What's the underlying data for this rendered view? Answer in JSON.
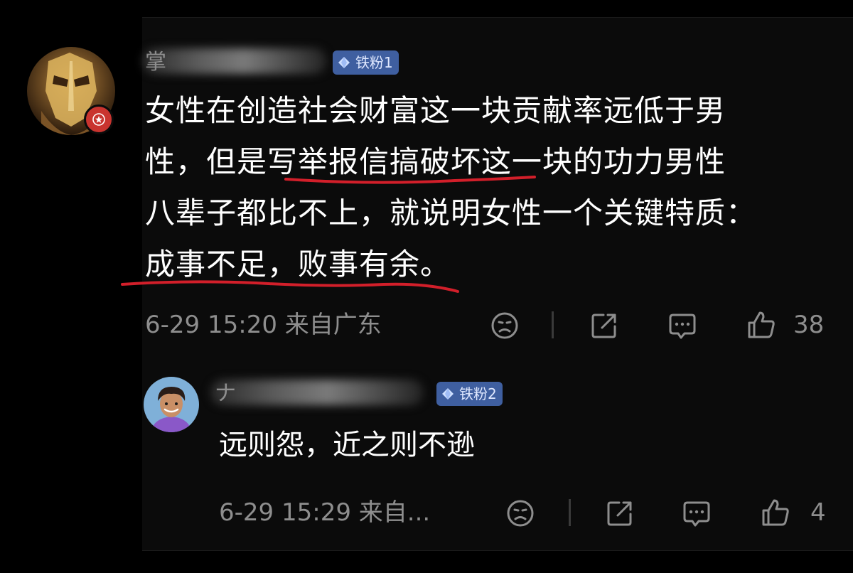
{
  "comment": {
    "username_hint": "掌",
    "fan_badge": "铁粉1",
    "lines": [
      "女性在创造社会财富这一块贡献率远低于男",
      "性，但是写举报信搞破坏这一块的功力男性",
      "八辈子都比不上，就说明女性一个关键特质：",
      "成事不足，败事有余。"
    ],
    "timestamp": "6-29 15:20 来自广东",
    "likes": "38"
  },
  "reply": {
    "username_hint": "ナ",
    "fan_badge": "铁粉2",
    "text": "远则怨，近之则不逊",
    "timestamp": "6-29 15:29 来自...",
    "likes": "4"
  },
  "colors": {
    "background": "#000000",
    "meta_text": "#8e8e8e",
    "badge_bg": "#3f5fa0",
    "underline": "#d21f2a",
    "vip_badge": "#c9342f"
  },
  "icons": [
    "dislike-face-icon",
    "share-icon",
    "comment-icon",
    "thumbs-up-icon",
    "diamond-icon",
    "star-icon"
  ]
}
